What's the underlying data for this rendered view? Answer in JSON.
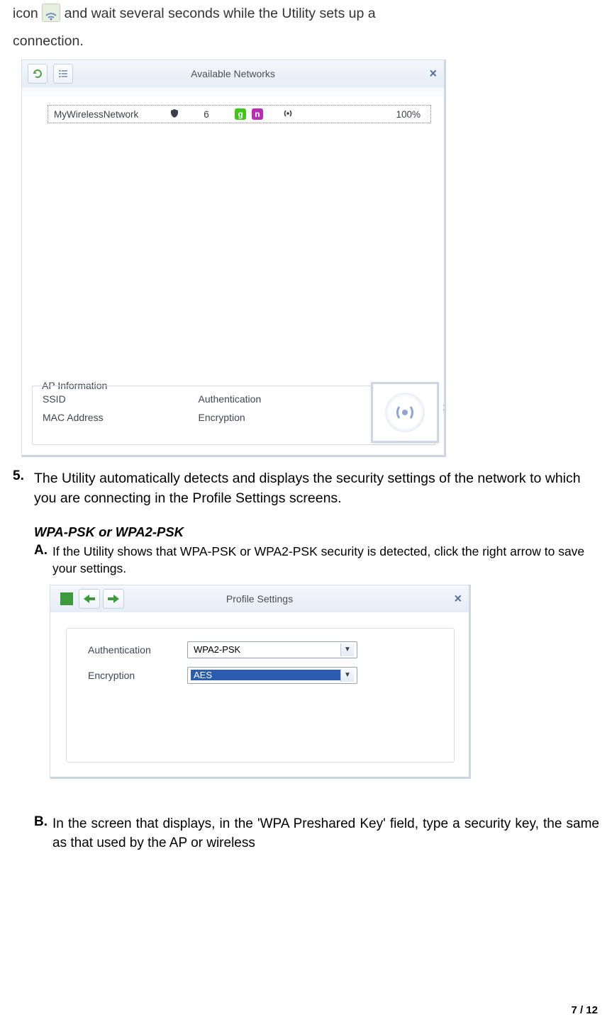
{
  "intro": {
    "line1_prefix": "icon",
    "line1_rest": " and  wait  several  seconds  while  the  Utility  sets  up  a",
    "line2": "connection."
  },
  "win1": {
    "title": "Available Networks",
    "row": {
      "ssid": "MyWirelessNetwork",
      "channel": "6",
      "badge_g": "g",
      "badge_n": "n",
      "signal_pct": "100%"
    },
    "ap_info_label": "AP Information",
    "labels": {
      "ssid": "SSID",
      "mac": "MAC Address",
      "auth": "Authentication",
      "enc": "Encryption"
    },
    "side_dot": ":"
  },
  "step5_num": "5.",
  "step5_text": "The Utility automatically detects and displays the security settings of the network to which you are connecting in the Profile Settings screens.",
  "sub_heading": "WPA-PSK or WPA2-PSK",
  "subA_letter": "A.",
  "subA_text": "If the Utility shows that WPA-PSK or WPA2-PSK security is detected, click the right arrow to save your settings.",
  "win2": {
    "title": "Profile Settings",
    "auth_label": "Authentication",
    "auth_value": "WPA2-PSK",
    "enc_label": "Encryption",
    "enc_value": "AES"
  },
  "subB_letter": "B.",
  "subB_text": "In the screen that displays, in the 'WPA Preshared Key' field, type a security key, the same as that used by the AP or wireless",
  "footer": {
    "page_num": "7",
    "sep": " / ",
    "total": "12"
  }
}
